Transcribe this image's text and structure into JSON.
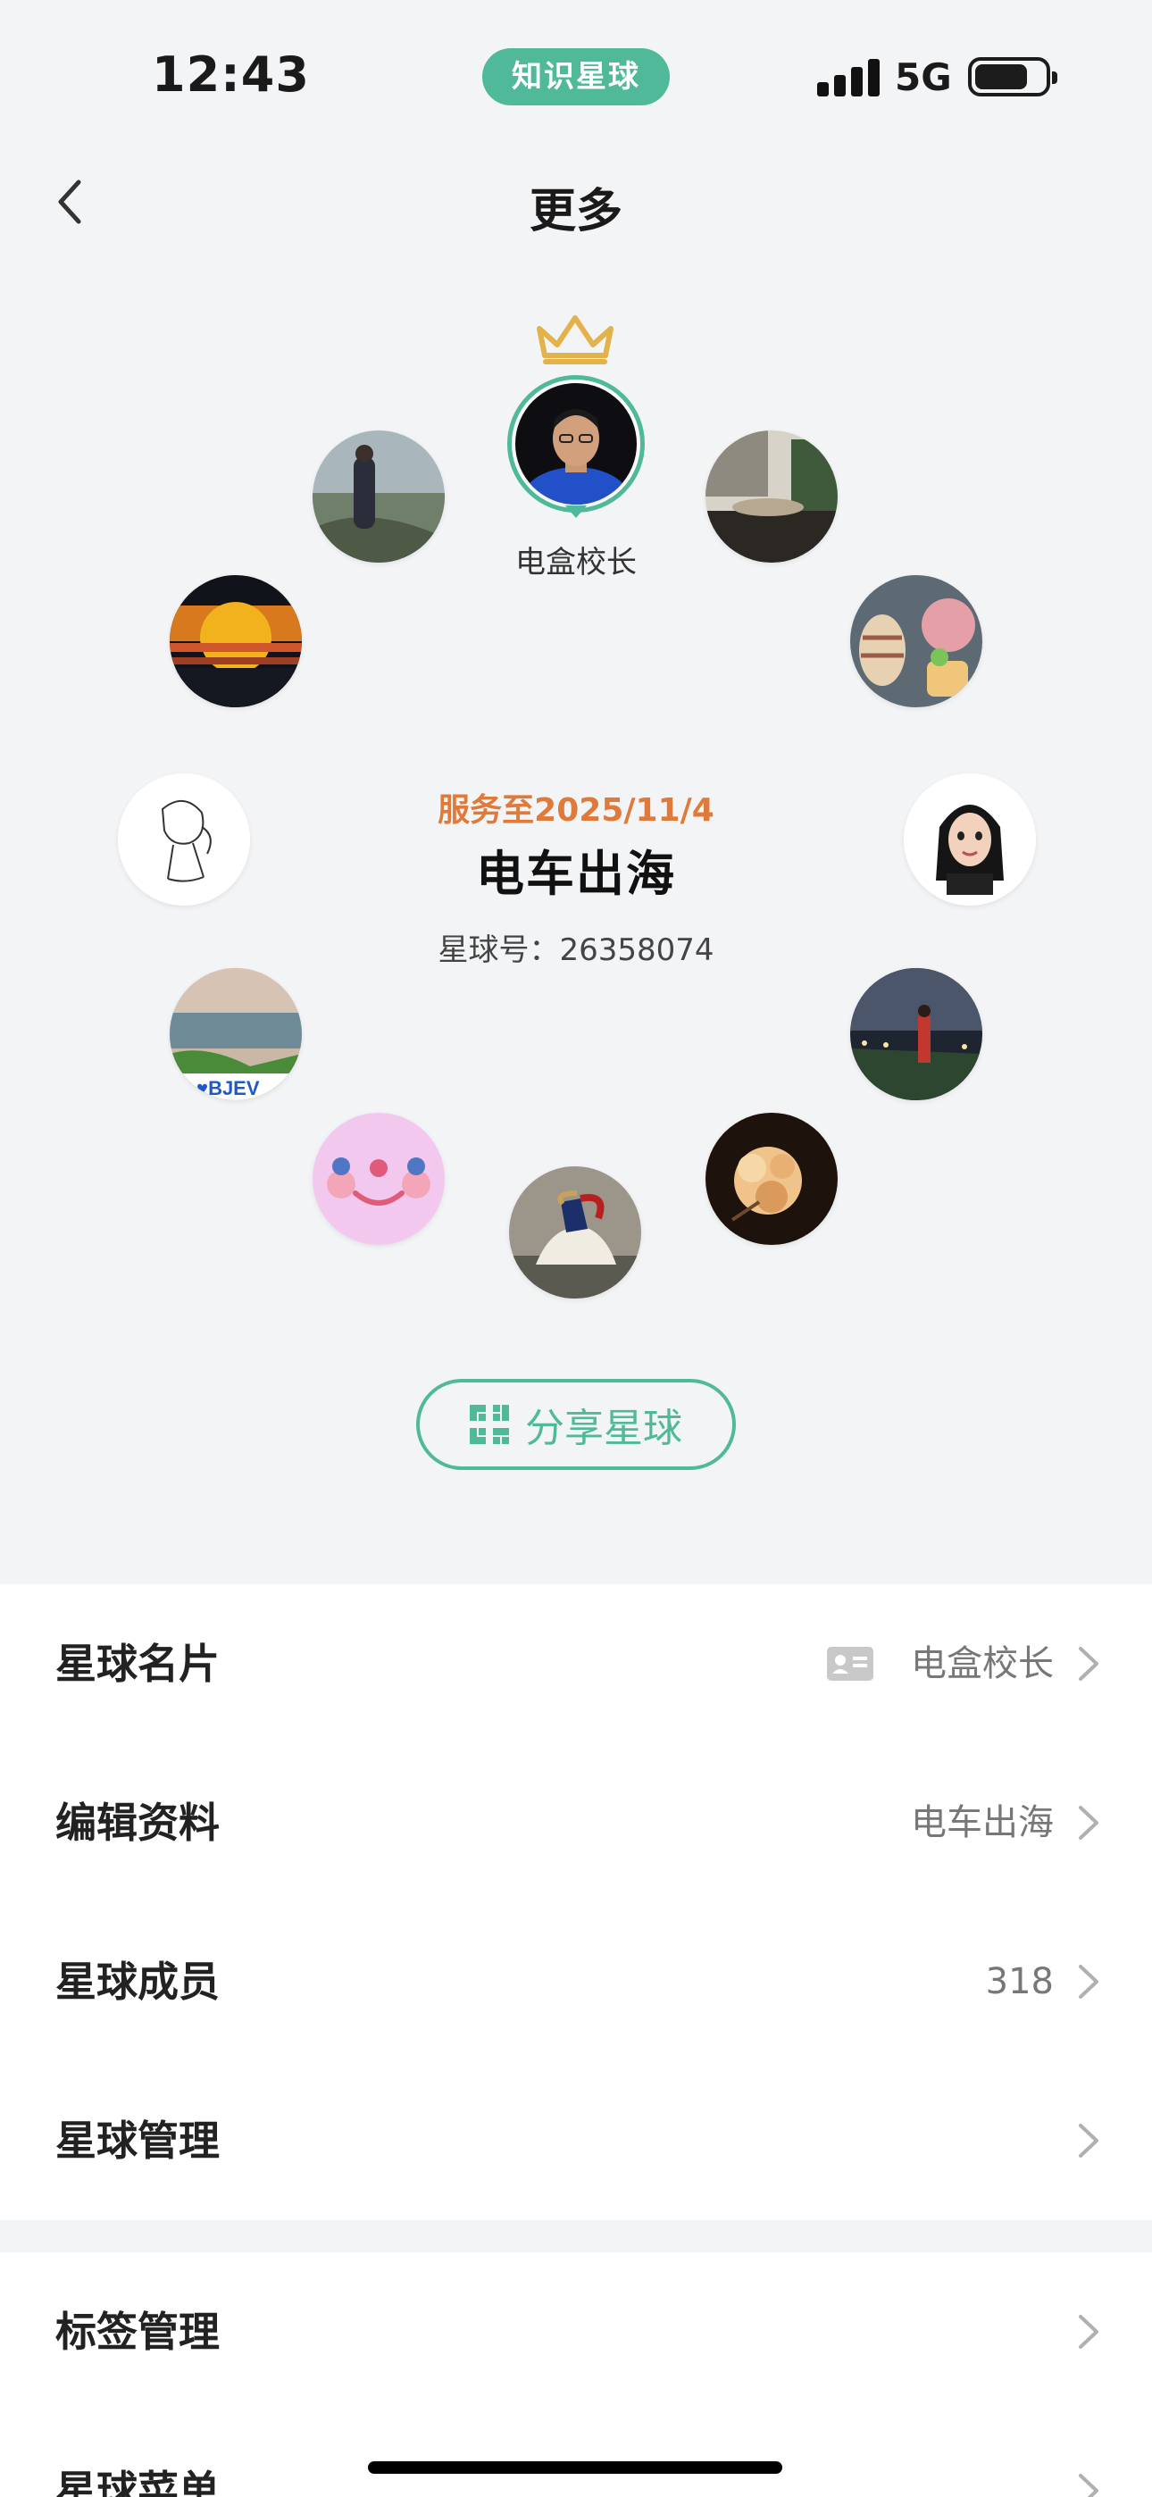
{
  "status_bar": {
    "time": "12:43",
    "app_badge": "知识星球",
    "network": "5G"
  },
  "header": {
    "title": "更多"
  },
  "owner": {
    "name": "电盒校长"
  },
  "group": {
    "service_until": "服务至2025/11/4",
    "name": "电车出海",
    "id_label": "星球号：26358074"
  },
  "share_button": {
    "label": "分享星球"
  },
  "menu": [
    {
      "label": "星球名片",
      "value": "电盒校长"
    },
    {
      "label": "编辑资料",
      "value": "电车出海"
    },
    {
      "label": "星球成员",
      "value": "318"
    },
    {
      "label": "星球管理",
      "value": ""
    }
  ],
  "menu2": [
    {
      "label": "标签管理",
      "value": ""
    },
    {
      "label": "星球菜单",
      "value": ""
    }
  ],
  "colors": {
    "accent": "#4fb99a",
    "service": "#e07a3a",
    "background": "#f3f4f6"
  },
  "icons": [
    "back-arrow-icon",
    "crown-icon",
    "qr-code-icon",
    "card-icon",
    "chevron-right-icon",
    "signal-icon",
    "battery-icon"
  ]
}
